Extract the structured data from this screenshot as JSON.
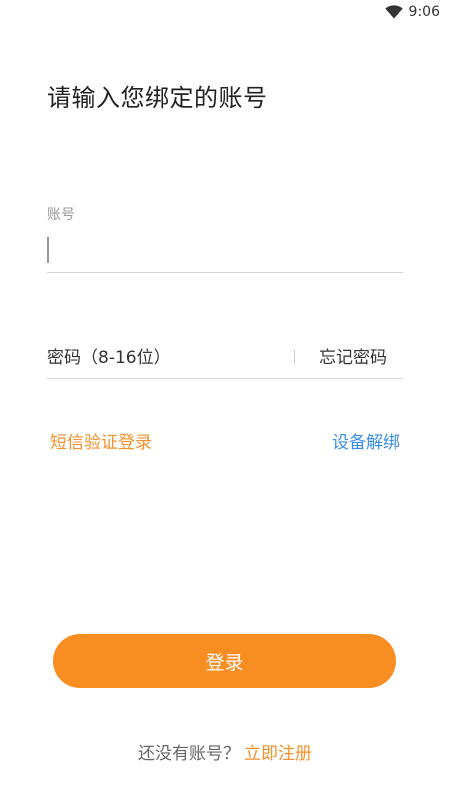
{
  "status_bar": {
    "time": "9:06",
    "icons": [
      "wifi-icon"
    ]
  },
  "title": "请输入您绑定的账号",
  "account": {
    "label": "账号",
    "value": ""
  },
  "password": {
    "placeholder": "密码（8-16位）",
    "forgot_label": "忘记密码"
  },
  "links": {
    "sms_login": "短信验证登录",
    "unbind_device": "设备解绑"
  },
  "login_button": "登录",
  "register": {
    "prompt": "还没有账号？",
    "link": "立即注册"
  },
  "colors": {
    "accent": "#f88d22",
    "link_orange": "#f5902a",
    "link_blue": "#3a8ee6"
  }
}
